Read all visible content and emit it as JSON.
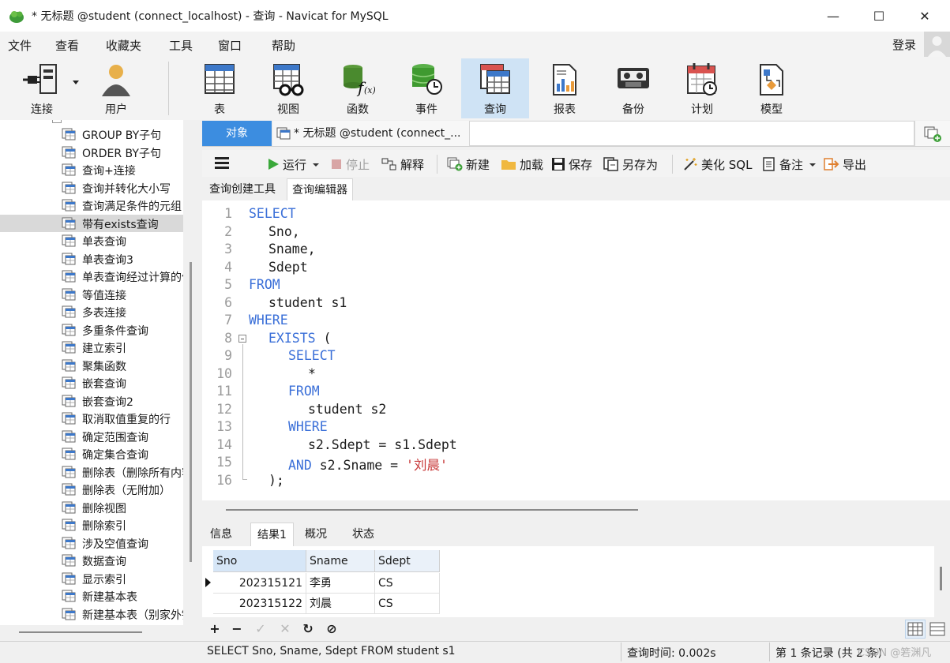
{
  "window": {
    "title": "* 无标题 @student (connect_localhost) - 查询 - Navicat for MySQL",
    "minimize": "—",
    "maximize": "☐",
    "close": "✕"
  },
  "menu": [
    "文件",
    "查看",
    "收藏夹",
    "工具",
    "窗口",
    "帮助"
  ],
  "login": "登录",
  "toolbar": [
    {
      "label": "连接",
      "icon": "plug-icon"
    },
    {
      "label": "用户",
      "icon": "user-icon"
    },
    {
      "label": "表",
      "icon": "table-icon"
    },
    {
      "label": "视图",
      "icon": "view-icon"
    },
    {
      "label": "函数",
      "icon": "function-icon"
    },
    {
      "label": "事件",
      "icon": "event-icon"
    },
    {
      "label": "查询",
      "icon": "query-icon",
      "active": true
    },
    {
      "label": "报表",
      "icon": "report-icon"
    },
    {
      "label": "备份",
      "icon": "backup-icon"
    },
    {
      "label": "计划",
      "icon": "schedule-icon"
    },
    {
      "label": "模型",
      "icon": "model-icon"
    }
  ],
  "tree": {
    "items": [
      "GROUP BY子句",
      "ORDER BY子句",
      "查询+连接",
      "查询并转化大小写",
      "查询满足条件的元组",
      "带有exists查询",
      "单表查询",
      "单表查询3",
      "单表查询经过计算的值",
      "等值连接",
      "多表连接",
      "多重条件查询",
      "建立索引",
      "聚集函数",
      "嵌套查询",
      "嵌套查询2",
      "取消取值重复的行",
      "确定范围查询",
      "确定集合查询",
      "删除表（删除所有内容）",
      "删除表（无附加）",
      "删除视图",
      "删除索引",
      "涉及空值查询",
      "数据查询",
      "显示索引",
      "新建基本表",
      "新建基本表（别家外键）"
    ],
    "selected_index": 5
  },
  "doc_tabs": {
    "objects": "对象",
    "query": "* 无标题 @student (connect_..."
  },
  "query_toolbar": {
    "run": "运行",
    "stop": "停止",
    "explain": "解释",
    "new": "新建",
    "load": "加载",
    "save": "保存",
    "save_as": "另存为",
    "beautify": "美化 SQL",
    "comment": "备注",
    "export": "导出"
  },
  "sub_tabs": [
    "查询创建工具",
    "查询编辑器"
  ],
  "editor": {
    "lines": [
      {
        "n": "1",
        "indent": 0,
        "parts": [
          {
            "t": "SELECT",
            "c": "kw"
          }
        ]
      },
      {
        "n": "2",
        "indent": 1,
        "parts": [
          {
            "t": "Sno,",
            "c": "id"
          }
        ]
      },
      {
        "n": "3",
        "indent": 1,
        "parts": [
          {
            "t": "Sname,",
            "c": "id"
          }
        ]
      },
      {
        "n": "4",
        "indent": 1,
        "parts": [
          {
            "t": "Sdept",
            "c": "id"
          }
        ]
      },
      {
        "n": "5",
        "indent": 0,
        "parts": [
          {
            "t": "FROM",
            "c": "kw"
          }
        ]
      },
      {
        "n": "6",
        "indent": 1,
        "parts": [
          {
            "t": "student s1",
            "c": "id"
          }
        ]
      },
      {
        "n": "7",
        "indent": 0,
        "parts": [
          {
            "t": "WHERE",
            "c": "kw"
          }
        ]
      },
      {
        "n": "8",
        "indent": 1,
        "parts": [
          {
            "t": "EXISTS",
            "c": "kw"
          },
          {
            "t": " (",
            "c": "id"
          }
        ]
      },
      {
        "n": "9",
        "indent": 2,
        "parts": [
          {
            "t": "SELECT",
            "c": "kw"
          }
        ]
      },
      {
        "n": "10",
        "indent": 3,
        "parts": [
          {
            "t": "*",
            "c": "id"
          }
        ]
      },
      {
        "n": "11",
        "indent": 2,
        "parts": [
          {
            "t": "FROM",
            "c": "kw"
          }
        ]
      },
      {
        "n": "12",
        "indent": 3,
        "parts": [
          {
            "t": "student s2",
            "c": "id"
          }
        ]
      },
      {
        "n": "13",
        "indent": 2,
        "parts": [
          {
            "t": "WHERE",
            "c": "kw"
          }
        ]
      },
      {
        "n": "14",
        "indent": 3,
        "parts": [
          {
            "t": "s2.Sdept = s1.Sdept",
            "c": "id"
          }
        ]
      },
      {
        "n": "15",
        "indent": 2,
        "parts": [
          {
            "t": "AND",
            "c": "kw"
          },
          {
            "t": " s2.Sname = ",
            "c": "id"
          },
          {
            "t": "'刘晨'",
            "c": "str"
          }
        ]
      },
      {
        "n": "16",
        "indent": 1,
        "parts": [
          {
            "t": ");",
            "c": "id"
          }
        ]
      }
    ]
  },
  "result_tabs": [
    "信息",
    "结果1",
    "概况",
    "状态"
  ],
  "result_grid": {
    "columns": [
      "Sno",
      "Sname",
      "Sdept"
    ],
    "rows": [
      [
        "202315121",
        "李勇",
        "CS"
      ],
      [
        "202315122",
        "刘晨",
        "CS"
      ]
    ]
  },
  "grid_toolbar": [
    "+",
    "−",
    "✓",
    "✕",
    "↻",
    "⊘"
  ],
  "status": {
    "sql": "SELECT   Sno,      Sname,    Sdept FROM      student s1",
    "time": "查询时间: 0.002s",
    "records": "第 1 条记录 (共 2 条)",
    "watermark": "CSDN @箬渊凡"
  },
  "colors": {
    "accent": "#3c8de0",
    "keyword": "#3a6fd8",
    "string": "#c83a3a",
    "active_tool": "#cfe3f5"
  }
}
